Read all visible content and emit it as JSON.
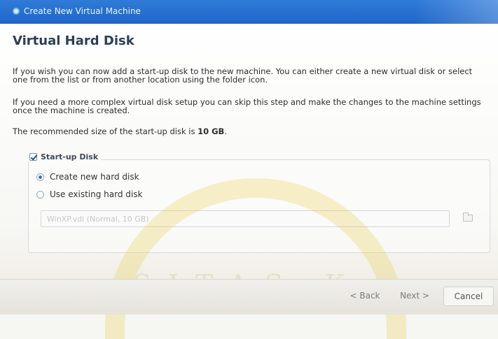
{
  "window": {
    "title": "Create New Virtual Machine"
  },
  "page": {
    "heading": "Virtual Hard Disk",
    "paragraph1": "If you wish you can now add a start-up disk to the new machine. You can either create a new virtual disk or select one from the list or from another location using the folder icon.",
    "paragraph2": "If you need a more complex virtual disk setup you can skip this step and make the changes to the machine settings once the machine is created.",
    "paragraph3_prefix": "The recommended size of the start-up disk is ",
    "paragraph3_size": "10 GB",
    "paragraph3_suffix": "."
  },
  "startup_disk": {
    "label": "Start-up Disk",
    "checked": true,
    "options": [
      {
        "label": "Create new hard disk",
        "selected": true
      },
      {
        "label": "Use existing hard disk",
        "selected": false
      }
    ],
    "combo_value": "WinXP.vdi (Normal, 10 GB)"
  },
  "buttons": {
    "back": "< Back",
    "next": "Next >",
    "cancel": "Cancel"
  },
  "watermark": {
    "text": "SITAS K"
  },
  "colors": {
    "titlebar": "#1f66c8",
    "heading": "#2b3f57"
  }
}
